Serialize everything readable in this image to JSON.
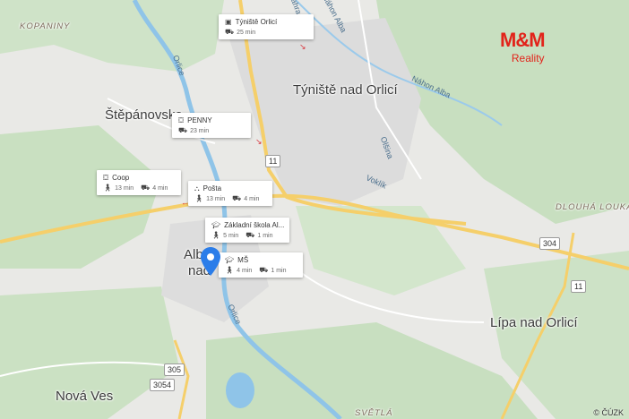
{
  "places": {
    "kopaniny": "KOPANINY",
    "tyniste": "Týniště nad Orlicí",
    "stepanovsko": "Štěpánovsko",
    "albrechtice_1": "Alb",
    "albrechtice_2": "nad",
    "nova_ves": "Nová Ves",
    "lipa": "Lípa nad Orlicí",
    "dlouha_louka": "DLOUHÁ LOUKA",
    "svetla": "SVĚTLÁ"
  },
  "streets": {
    "orlice_1": "Orlice",
    "orlice_2": "Orlice",
    "nahon_alba_1": "Náhon Alba",
    "nahon_alba_2": "Náhon Alba",
    "olsina": "Olšina",
    "voklik": "Voklík",
    "zahrady": "Zahrady"
  },
  "road_numbers": {
    "r11_a": "11",
    "r11_b": "11",
    "r304": "304",
    "r305": "305",
    "r3054": "3054"
  },
  "pois": [
    {
      "name": "Týniště Orlicí",
      "icon": "bus-icon",
      "walk": "",
      "drive": "25 min"
    },
    {
      "name": "PENNY",
      "icon": "cart-icon",
      "walk": "",
      "drive": "23 min"
    },
    {
      "name": "Coop",
      "icon": "cart-icon",
      "walk": "13 min",
      "drive": "4 min"
    },
    {
      "name": "Pošta",
      "icon": "post-icon",
      "walk": "13 min",
      "drive": "4 min"
    },
    {
      "name": "Základní škola Al...",
      "icon": "school-icon",
      "walk": "5 min",
      "drive": "1 min"
    },
    {
      "name": "MŠ",
      "icon": "school-icon",
      "walk": "4 min",
      "drive": "1 min"
    }
  ],
  "brand": {
    "logo": "M&M",
    "sub": "Reality",
    "color": "#e2231a"
  },
  "credit": "© ČÚZK",
  "colors": {
    "forest": "#c7dfc0",
    "water": "#8fc4e8",
    "road": "#f5cf6a",
    "urban": "#dedede",
    "pin": "#2b7de9"
  }
}
